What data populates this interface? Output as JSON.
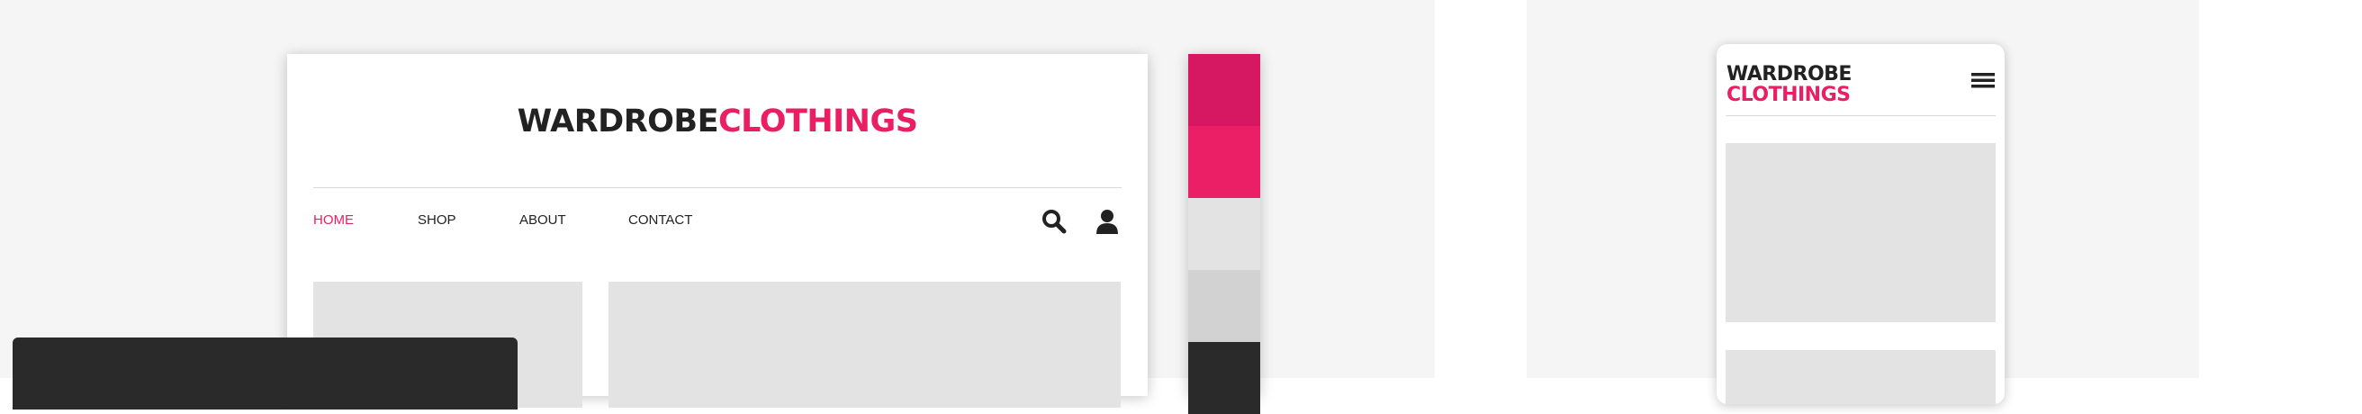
{
  "colors": {
    "brand_pink": "#e91e63",
    "text_dark": "#222222",
    "placeholder_gray": "#e3e3e3"
  },
  "desktop": {
    "logo": {
      "part1": "WARDROBE",
      "part2": "CLOTHINGS"
    },
    "nav": {
      "items": [
        {
          "label": "HOME",
          "active": true
        },
        {
          "label": "SHOP",
          "active": false
        },
        {
          "label": "ABOUT",
          "active": false
        },
        {
          "label": "CONTACT",
          "active": false
        }
      ]
    },
    "icons": [
      "search-icon",
      "user-icon"
    ]
  },
  "palette": {
    "swatches": [
      "#d61863",
      "#eb1f66",
      "#e3e3e3",
      "#d2d2d2",
      "#2a2a2a"
    ]
  },
  "mobile": {
    "logo": {
      "part1": "WARDROBE",
      "part2": "CLOTHINGS"
    },
    "icons": [
      "hamburger-menu-icon"
    ]
  }
}
